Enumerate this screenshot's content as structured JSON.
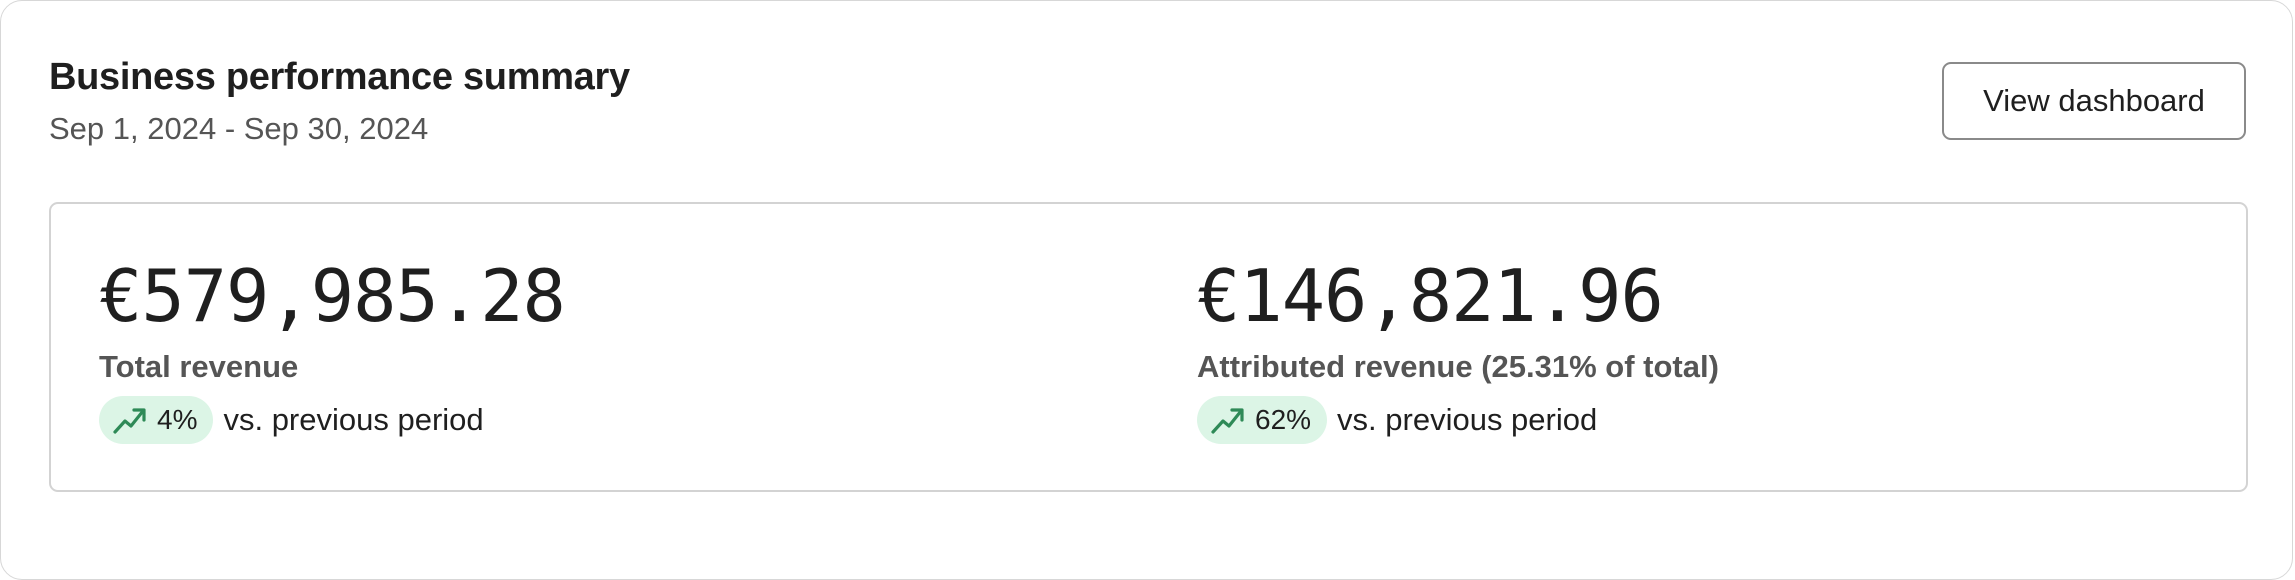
{
  "header": {
    "title": "Business performance summary",
    "date_range": "Sep 1, 2024 - Sep 30, 2024",
    "view_button_label": "View dashboard"
  },
  "metrics": [
    {
      "value": "€579,985.28",
      "label": "Total revenue",
      "change": "4%",
      "trend_icon": "trending-up-icon",
      "comparison_text": "vs. previous period"
    },
    {
      "value": "€146,821.96",
      "label": "Attributed revenue (25.31% of total)",
      "change": "62%",
      "trend_icon": "trending-up-icon",
      "comparison_text": "vs. previous period"
    }
  ],
  "colors": {
    "badge_background": "#dcf5e6",
    "trend_up": "#2e8a57",
    "border": "#d3d3d3"
  }
}
